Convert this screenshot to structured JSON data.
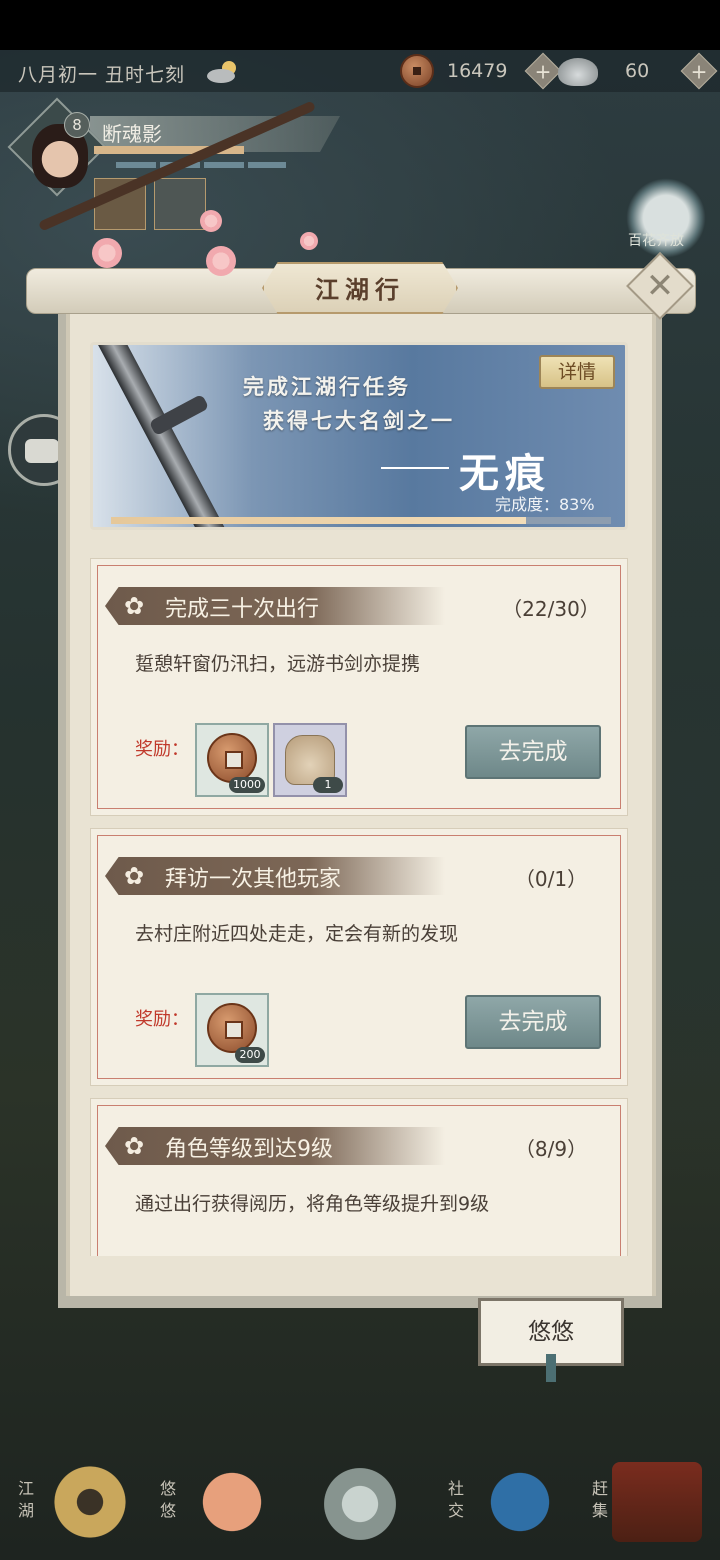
{
  "status_bar": {
    "date": "八月初一  丑时七刻",
    "weather_icon": "partly-cloudy-icon",
    "copper_coins": "16479",
    "silver": "60",
    "plus_symbol": "+"
  },
  "player": {
    "level": "8",
    "name": "断魂影"
  },
  "side": {
    "lotus_label": "百花齐放"
  },
  "panel": {
    "title": "江湖行",
    "close_symbol": "✕",
    "banner": {
      "line1": "完成江湖行任务",
      "line2": "获得七大名剑之一",
      "sword_name": "无痕",
      "details_button": "详情",
      "progress_label": "完成度：83%",
      "progress_value": 0.83
    },
    "tasks": [
      {
        "name": "完成三十次出行",
        "progress": "（22/30）",
        "description": "踅憩轩窗仍汛扫，远游书剑亦提携",
        "reward_label": "奖励：",
        "rewards": [
          {
            "icon": "copper-coin-icon",
            "qty": "1000"
          },
          {
            "icon": "cloth-bundle-icon",
            "qty": "1"
          }
        ],
        "button": "去完成"
      },
      {
        "name": "拜访一次其他玩家",
        "progress": "（0/1）",
        "description": "去村庄附近四处走走，定会有新的发现",
        "reward_label": "奖励：",
        "rewards": [
          {
            "icon": "copper-coin-icon",
            "qty": "200"
          }
        ],
        "button": "去完成"
      },
      {
        "name": "角色等级到达9级",
        "progress": "（8/9）",
        "description": "通过出行获得阅历，将角色等级提升到9级"
      }
    ]
  },
  "youyou_button": "悠悠",
  "bottom_nav": [
    {
      "label": "江湖",
      "icon": "straw-hat-icon"
    },
    {
      "label": "悠悠",
      "icon": "crane-icon"
    },
    {
      "label": "",
      "icon": "compass-star-icon"
    },
    {
      "label": "社交",
      "icon": "wave-icon"
    },
    {
      "label": "赶集",
      "icon": "basket-icon"
    }
  ],
  "colors": {
    "panel_bg": "#e9e3d3",
    "accent_red": "#c0392b",
    "button_teal": "#7f999a",
    "ribbon_brown": "#6e5a4b"
  }
}
